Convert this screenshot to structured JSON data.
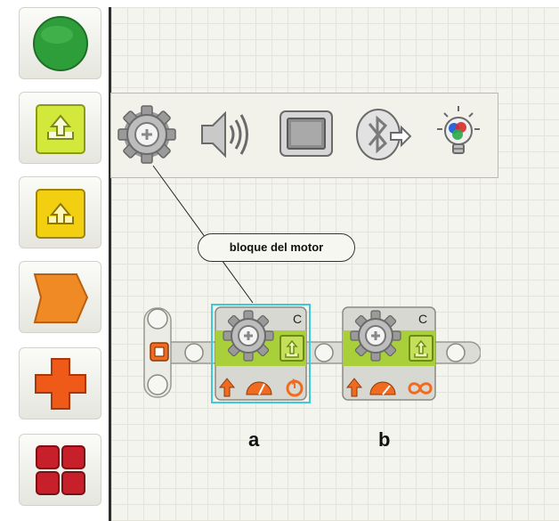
{
  "palette": {
    "items": [
      {
        "icon": "green-circle-icon",
        "color": "#2d9e3a"
      },
      {
        "icon": "action-blocks-icon",
        "color": "#d2e83a"
      },
      {
        "icon": "sensor-blocks-icon",
        "color": "#f2cf10"
      },
      {
        "icon": "flow-blocks-icon",
        "color": "#f08a24"
      },
      {
        "icon": "data-blocks-icon",
        "color": "#f05a18"
      },
      {
        "icon": "advanced-blocks-icon",
        "color": "#c8202a"
      }
    ]
  },
  "flyout": {
    "icons": [
      "motor-gear-icon",
      "sound-speaker-icon",
      "display-screen-icon",
      "bluetooth-send-icon",
      "lamp-bulb-icon"
    ]
  },
  "callout": {
    "text": "bloque del motor"
  },
  "blocks": [
    {
      "port": "C",
      "label": "a",
      "selected": true,
      "mode_icon": "rotations-icon"
    },
    {
      "port": "C",
      "label": "b",
      "selected": false,
      "mode_icon": "infinity-icon"
    }
  ],
  "colors": {
    "block_band": "#a9cf3a",
    "selection": "#3ec8d8",
    "accent_orange": "#f06a20"
  }
}
